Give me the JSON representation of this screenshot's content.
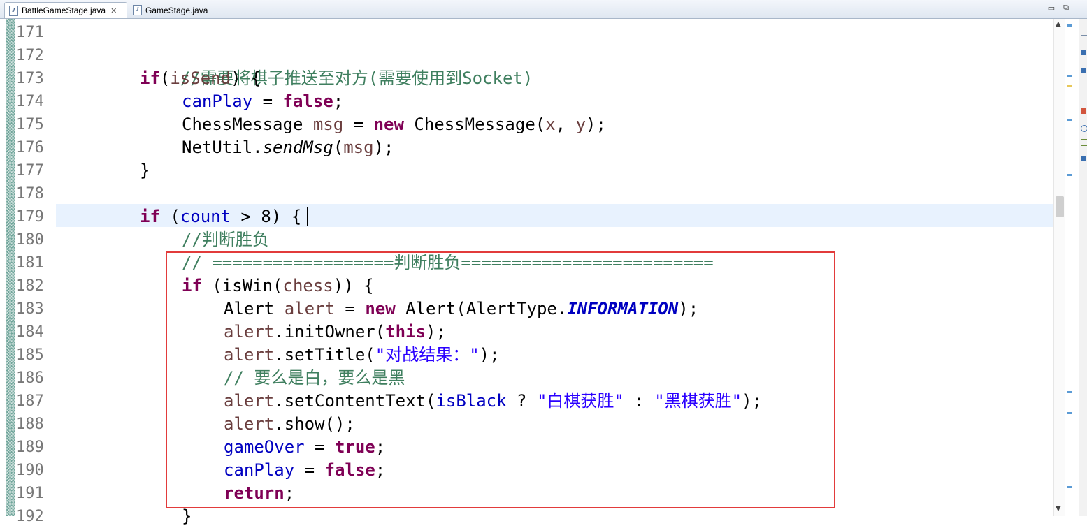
{
  "tabs": [
    {
      "label": "BattleGameStage.java",
      "icon": "java-file-icon",
      "active": true,
      "close_glyph": "✕"
    },
    {
      "label": "GameStage.java",
      "icon": "java-file-icon",
      "active": false
    }
  ],
  "window_controls": {
    "minimize": "▭",
    "maximize": "⧉"
  },
  "line_numbers": [
    "171",
    "172",
    "173",
    "174",
    "175",
    "176",
    "177",
    "178",
    "179",
    "180",
    "181",
    "182",
    "183",
    "184",
    "185",
    "186",
    "187",
    "188",
    "189",
    "190",
    "191",
    "192"
  ],
  "code": {
    "l172": {
      "comment": "//需要将棋子推送至对方(需要使用到Socket)"
    },
    "l173": {
      "kw_if": "if",
      "open": "(",
      "var": "isSend",
      "close": ") {"
    },
    "l174": {
      "field": "canPlay",
      "op": " = ",
      "kw": "false",
      "semi": ";"
    },
    "l175": {
      "type": "ChessMessage ",
      "local": "msg",
      "op": " = ",
      "kw_new": "new",
      "ctor": " ChessMessage(",
      "x": "x",
      "comma": ", ",
      "y": "y",
      "end": ");"
    },
    "l176": {
      "cls": "NetUtil.",
      "method": "sendMsg",
      "open": "(",
      "arg": "msg",
      "end": ");"
    },
    "l177": {
      "text": "}"
    },
    "l179": {
      "kw_if": "if",
      "open": " (",
      "field": "count",
      "rest": " > 8) {"
    },
    "l180": {
      "comment": "//判断胜负"
    },
    "l181": {
      "comment": "// ==================判断胜负========================="
    },
    "l182": {
      "kw_if": "if",
      "open": " (isWin(",
      "local": "chess",
      "close": ")) {"
    },
    "l183": {
      "type": "Alert ",
      "local": "alert",
      "op": " = ",
      "kw_new": "new",
      "ctor": " Alert(AlertType.",
      "const": "INFORMATION",
      "end": ");"
    },
    "l184": {
      "local": "alert",
      "call": ".initOwner(",
      "kw_this": "this",
      "end": ");"
    },
    "l185": {
      "local": "alert",
      "call": ".setTitle(",
      "str": "\"对战结果：\"",
      "end": ");"
    },
    "l186": {
      "comment": "// 要么是白，要么是黑"
    },
    "l187": {
      "local": "alert",
      "call": ".setContentText(",
      "field": "isBlack",
      "q": " ? ",
      "str1": "\"白棋获胜\"",
      "colon": " : ",
      "str2": "\"黑棋获胜\"",
      "end": ");"
    },
    "l188": {
      "local": "alert",
      "call": ".show();"
    },
    "l189": {
      "field": "gameOver",
      "op": " = ",
      "kw": "true",
      "semi": ";"
    },
    "l190": {
      "field": "canPlay",
      "op": " = ",
      "kw": "false",
      "semi": ";"
    },
    "l191": {
      "kw": "return",
      "semi": ";"
    },
    "l192": {
      "text": "}"
    }
  },
  "colors": {
    "keyword": "#7f0055",
    "field": "#0000c0",
    "local_variable": "#6a3e3e",
    "comment": "#3f7f5f",
    "string": "#2a00ff",
    "highlight_box": "#e23b3b",
    "current_line": "#e8f2fe"
  },
  "scrollbar": {
    "up": "▲",
    "down": "▼"
  }
}
